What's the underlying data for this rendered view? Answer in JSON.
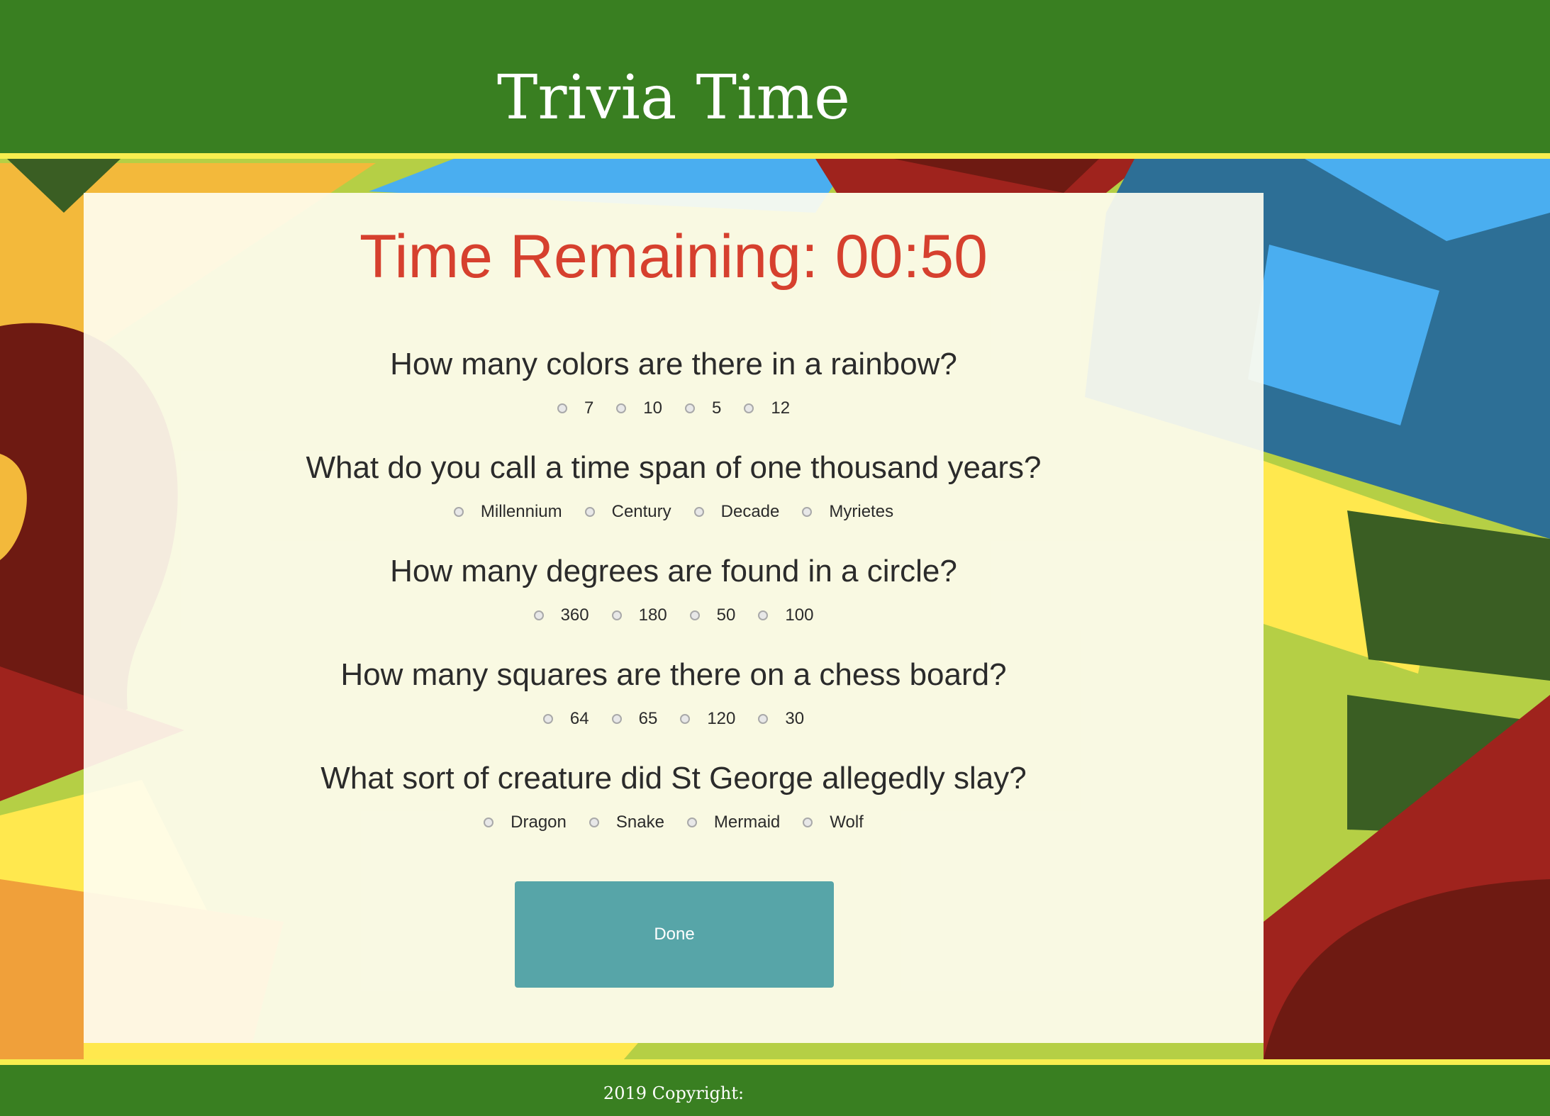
{
  "header": {
    "title": "Trivia Time"
  },
  "quiz": {
    "timer_label": "Time Remaining:",
    "timer_value": "00:50",
    "questions": [
      {
        "text": "How many colors are there in a rainbow?",
        "options": [
          "7",
          "10",
          "5",
          "12"
        ]
      },
      {
        "text": "What do you call a time span of one thousand years?",
        "options": [
          "Millennium",
          "Century",
          "Decade",
          "Myrietes"
        ]
      },
      {
        "text": "How many degrees are found in a circle?",
        "options": [
          "360",
          "180",
          "50",
          "100"
        ]
      },
      {
        "text": "How many squares are there on a chess board?",
        "options": [
          "64",
          "65",
          "120",
          "30"
        ]
      },
      {
        "text": "What sort of creature did St George allegedly slay?",
        "options": [
          "Dragon",
          "Snake",
          "Mermaid",
          "Wolf"
        ]
      }
    ],
    "done_label": "Done"
  },
  "footer": {
    "copyright": "2019 Copyright:"
  },
  "colors": {
    "header_green": "#397f21",
    "accent_yellow": "#f7ee4f",
    "timer_red": "#d6402e",
    "button_teal": "#57a5a8"
  }
}
